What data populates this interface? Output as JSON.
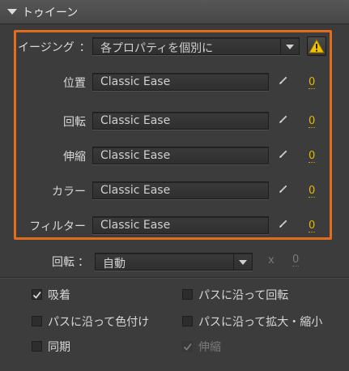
{
  "header": {
    "title": "トゥイーン"
  },
  "easing_panel": {
    "easing_label": "イージング",
    "separator": "：",
    "easing_dropdown": "各プロパティを個別に",
    "rows": [
      {
        "label": "位置",
        "value": "Classic Ease",
        "number": "0"
      },
      {
        "label": "回転",
        "value": "Classic Ease",
        "number": "0"
      },
      {
        "label": "伸縮",
        "value": "Classic Ease",
        "number": "0"
      },
      {
        "label": "カラー",
        "value": "Classic Ease",
        "number": "0"
      },
      {
        "label": "フィルター",
        "value": "Classic Ease",
        "number": "0"
      }
    ]
  },
  "rotation": {
    "label": "回転",
    "separator": "：",
    "dropdown": "自動",
    "times": "x",
    "count": "0"
  },
  "options": {
    "snap": {
      "label": "吸着",
      "checked": true
    },
    "orient_to_path": {
      "label": "パスに沿って回転",
      "checked": false
    },
    "color_along_path": {
      "label": "パスに沿って色付け",
      "checked": false
    },
    "scale_along_path": {
      "label": "パスに沿って拡大・縮小",
      "checked": false
    },
    "sync": {
      "label": "同期",
      "checked": false
    },
    "scale": {
      "label": "伸縮",
      "checked": true,
      "disabled": true
    }
  },
  "colors": {
    "accent": "#e46d1d",
    "value_link": "#e6b800",
    "warning": "#f2c200"
  }
}
